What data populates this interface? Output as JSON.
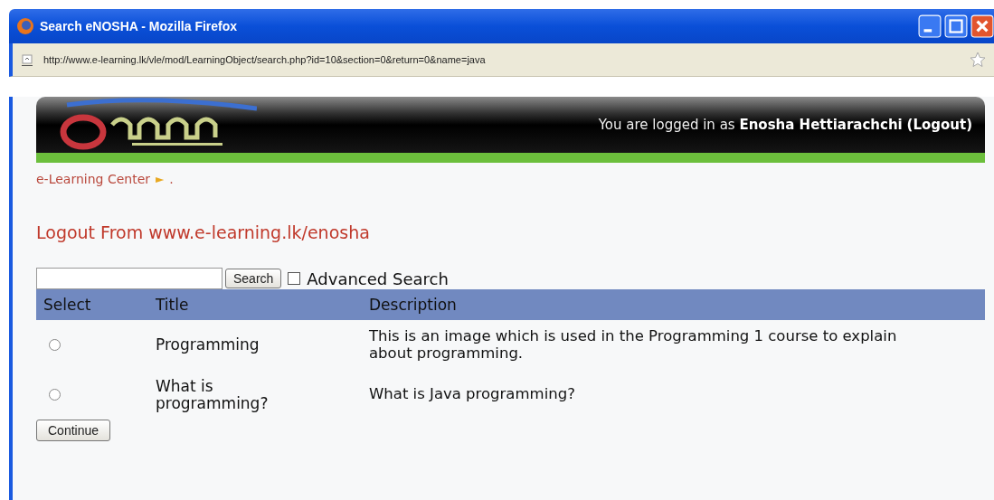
{
  "window": {
    "title": "Search eNOSHA - Mozilla Firefox"
  },
  "address_bar": {
    "url": "http://www.e-learning.lk/vle/mod/LearningObject/search.php?id=10&section=0&return=0&name=java"
  },
  "header": {
    "login_text": "You are logged in as",
    "user": "Enosha Hettiarachchi",
    "logout": "(Logout)"
  },
  "breadcrumb": {
    "link": "e-Learning Center",
    "arrow": "►",
    "current": "."
  },
  "heading": "Logout From www.e-learning.lk/enosha",
  "search": {
    "button": "Search",
    "advanced": {
      "label": "Advanced Search",
      "checked": false
    }
  },
  "table": {
    "columns": [
      "Select",
      "Title",
      "Description"
    ],
    "rows": [
      {
        "selected": false,
        "title": "Programming",
        "description": "This is an image which is used in the Programming 1 course to explain about programming."
      },
      {
        "selected": false,
        "title": "What is programming?",
        "description": "What is Java programming?"
      }
    ]
  },
  "continue_button": "Continue"
}
